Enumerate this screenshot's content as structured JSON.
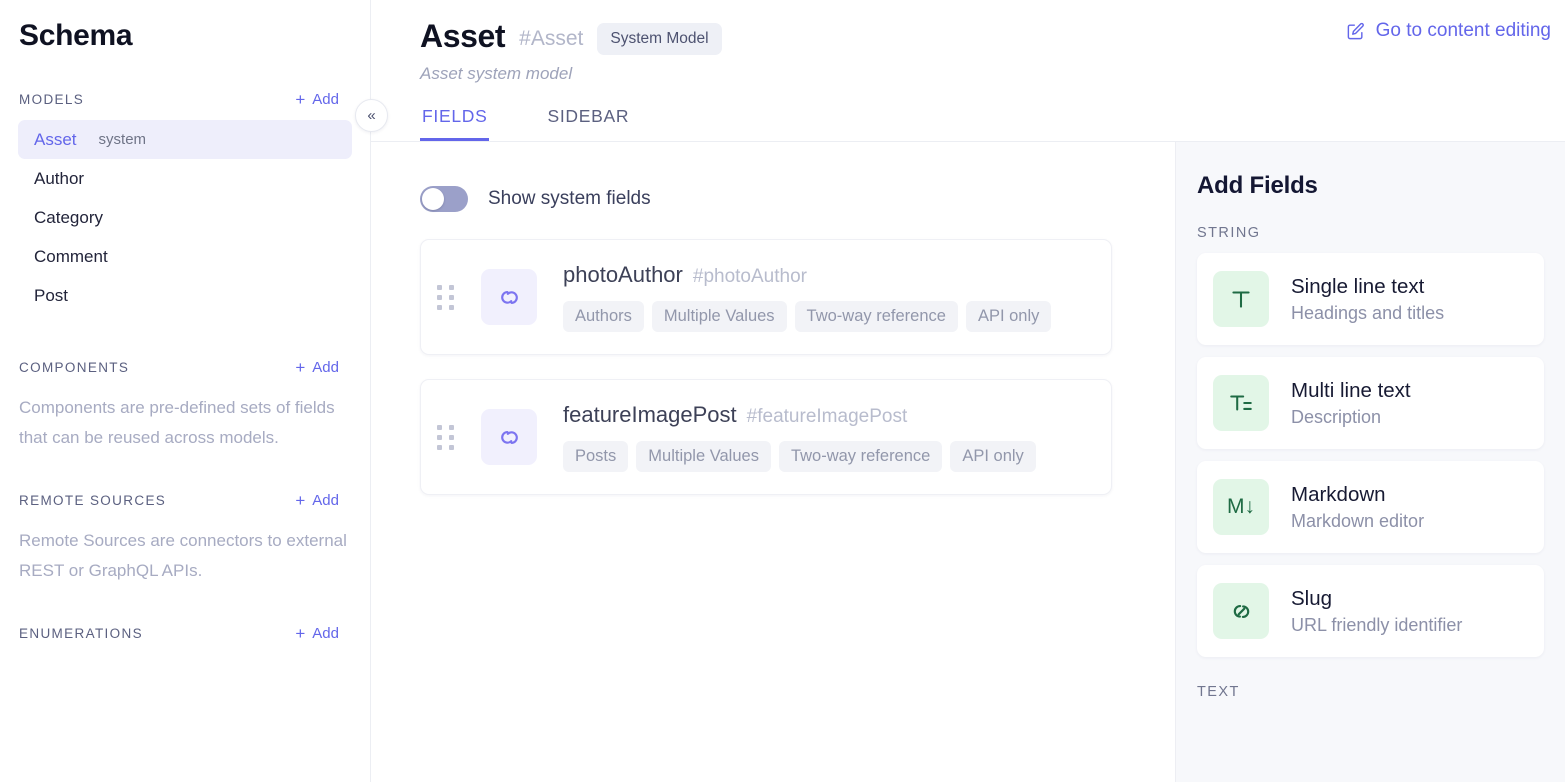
{
  "sidebar": {
    "title": "Schema",
    "sections": [
      {
        "label": "MODELS",
        "add_label": "Add"
      },
      {
        "label": "COMPONENTS",
        "add_label": "Add",
        "description": "Components are pre-defined sets of fields that can be reused across models."
      },
      {
        "label": "REMOTE SOURCES",
        "add_label": "Add",
        "description": "Remote Sources are connectors to external REST or GraphQL APIs."
      },
      {
        "label": "ENUMERATIONS",
        "add_label": "Add"
      }
    ],
    "models": [
      {
        "name": "Asset",
        "badge": "system",
        "selected": true
      },
      {
        "name": "Author",
        "badge": "",
        "selected": false
      },
      {
        "name": "Category",
        "badge": "",
        "selected": false
      },
      {
        "name": "Comment",
        "badge": "",
        "selected": false
      },
      {
        "name": "Post",
        "badge": "",
        "selected": false
      }
    ],
    "collapse_icon": "«"
  },
  "header": {
    "title": "Asset",
    "api_id": "#Asset",
    "badge": "System Model",
    "subtitle": "Asset system model",
    "goto_link": "Go to content editing"
  },
  "tabs": [
    {
      "label": "FIELDS",
      "active": true
    },
    {
      "label": "SIDEBAR",
      "active": false
    }
  ],
  "fields_panel": {
    "toggle_label": "Show system fields",
    "toggle_on": false,
    "fields": [
      {
        "name": "photoAuthor",
        "api_id": "#photoAuthor",
        "icon": "link-icon",
        "tags": [
          "Authors",
          "Multiple Values",
          "Two-way reference",
          "API only"
        ]
      },
      {
        "name": "featureImagePost",
        "api_id": "#featureImagePost",
        "icon": "link-icon",
        "tags": [
          "Posts",
          "Multiple Values",
          "Two-way reference",
          "API only"
        ]
      }
    ]
  },
  "add_fields": {
    "title": "Add Fields",
    "groups": [
      {
        "label": "STRING",
        "types": [
          {
            "name": "Single line text",
            "description": "Headings and titles",
            "icon": "single-line-text-icon",
            "glyph": "T"
          },
          {
            "name": "Multi line text",
            "description": "Description",
            "icon": "multi-line-text-icon",
            "glyph": ""
          },
          {
            "name": "Markdown",
            "description": "Markdown editor",
            "icon": "markdown-icon",
            "glyph": "M↓"
          },
          {
            "name": "Slug",
            "description": "URL friendly identifier",
            "icon": "slug-link-icon",
            "glyph": ""
          }
        ]
      },
      {
        "label": "TEXT",
        "types": []
      }
    ]
  },
  "colors": {
    "accent": "#6366ea",
    "accent_soft": "#eeeefb",
    "icon_green_bg": "#e2f6e7",
    "icon_green_fg": "#1f6b44",
    "panel_bg": "#f7f8fb",
    "tag_bg": "#f2f3f7"
  }
}
